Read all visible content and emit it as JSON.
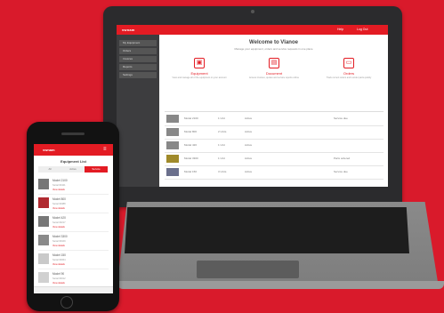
{
  "laptop": {
    "app": {
      "logo": "vwnam",
      "top_links": [
        "Help",
        "Log Out"
      ],
      "sidebar": [
        "My Equipment",
        "Orders",
        "Invoices",
        "Reports",
        "Settings"
      ],
      "welcome_title": "Welcome to Vlanoe",
      "welcome_subtitle": "Manage your equipment, orders and service requests in one place",
      "features": [
        {
          "label": "Equipment",
          "icon": "box-icon",
          "desc": "View and manage all of the equipment on your account"
        },
        {
          "label": "Document",
          "icon": "document-icon",
          "desc": "Access invoices, quotes and service reports online"
        },
        {
          "label": "Orders",
          "icon": "cart-icon",
          "desc": "Track current orders and reorder parts quickly"
        }
      ],
      "rows": [
        {
          "name": "Model 2100",
          "qty": "1 Unit",
          "status": "Active",
          "note": "Service due"
        },
        {
          "name": "Model 800",
          "qty": "2 Units",
          "status": "Active",
          "note": ""
        },
        {
          "name": "Model 420",
          "qty": "1 Unit",
          "status": "Active",
          "note": ""
        },
        {
          "name": "Model 3300",
          "qty": "1 Unit",
          "status": "Active",
          "note": "Parts ordered"
        },
        {
          "name": "Model 150",
          "qty": "3 Units",
          "status": "Active",
          "note": "Service due"
        }
      ]
    }
  },
  "phone": {
    "app": {
      "logo": "vwnam",
      "heading": "Equipment List",
      "tabs": [
        "All",
        "Active",
        "Service"
      ],
      "items": [
        {
          "title": "Model 2100",
          "sub": "Serial 00421",
          "link": "View details"
        },
        {
          "title": "Model 800",
          "sub": "Serial 00388",
          "link": "View details"
        },
        {
          "title": "Model 420",
          "sub": "Serial 00217",
          "link": "View details"
        },
        {
          "title": "Model 3300",
          "sub": "Serial 00109",
          "link": "View details"
        },
        {
          "title": "Model 150",
          "sub": "Serial 00064",
          "link": "View details"
        },
        {
          "title": "Model 90",
          "sub": "Serial 00012",
          "link": "View details"
        }
      ]
    }
  },
  "colors": {
    "background": "#d91a2b",
    "brand": "#e31b23",
    "sidebar": "#3d3d3f"
  }
}
